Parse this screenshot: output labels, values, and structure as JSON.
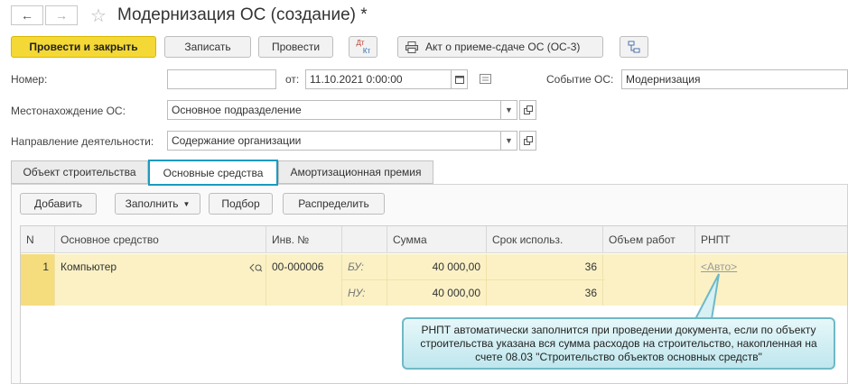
{
  "window": {
    "title": "Модернизация ОС (создание) *"
  },
  "nav": {
    "back": "←",
    "forward": "→",
    "star": "☆"
  },
  "toolbar": {
    "post_close": "Провести и закрыть",
    "save": "Записать",
    "post": "Провести",
    "dtkt_top": "Дт",
    "dtkt_bottom": "Кт",
    "print_act": "Акт о приеме-сдаче ОС (ОС-3)"
  },
  "form": {
    "number_label": "Номер:",
    "number_value": "",
    "date_label": "от:",
    "date_value": "11.10.2021  0:00:00",
    "event_label": "Событие ОС:",
    "event_value": "Модернизация",
    "location_label": "Местонахождение ОС:",
    "location_value": "Основное подразделение",
    "activity_label": "Направление деятельности:",
    "activity_value": "Содержание организации"
  },
  "tabs": [
    "Объект строительства",
    "Основные средства",
    "Амортизационная премия"
  ],
  "table_toolbar": {
    "add": "Добавить",
    "fill": "Заполнить",
    "select": "Подбор",
    "distribute": "Распределить"
  },
  "table": {
    "headers": [
      "N",
      "Основное средство",
      "Инв. №",
      "",
      "Сумма",
      "Срок использ.",
      "Объем работ",
      "РНПТ"
    ],
    "row": {
      "n": "1",
      "asset": "Компьютер",
      "inv": "00-000006",
      "bu_label": "БУ:",
      "nu_label": "НУ:",
      "sum_bu": "40 000,00",
      "sum_nu": "40 000,00",
      "term_bu": "36",
      "term_nu": "36",
      "work": "",
      "rnpt": "<Авто>"
    }
  },
  "callout": {
    "text": "РНПТ автоматически заполнится при проведении документа, если по объекту строительства указана вся сумма расходов на строительство, накопленная на счете 08.03 \"Строительство объектов основных средств\""
  },
  "colors": {
    "primary_button": "#f4d836",
    "active_tab_border": "#1a9bc0",
    "selected_row": "#fbf1c5",
    "callout_border": "#6fb9c6"
  }
}
